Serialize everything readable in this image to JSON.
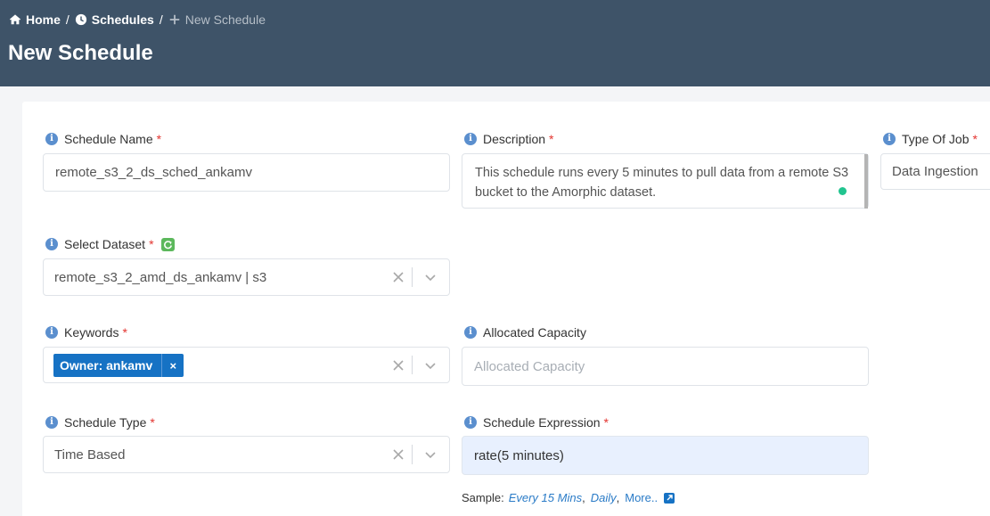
{
  "breadcrumb": {
    "home": "Home",
    "schedules": "Schedules",
    "current": "New Schedule",
    "separator": "/"
  },
  "page": {
    "title": "New Schedule"
  },
  "form": {
    "schedule_name": {
      "label": "Schedule Name",
      "value": "remote_s3_2_ds_sched_ankamv"
    },
    "description": {
      "label": "Description",
      "value": "This schedule runs every 5 minutes to pull data from a remote S3 bucket to the Amorphic dataset."
    },
    "type_of_job": {
      "label": "Type Of Job",
      "value": "Data Ingestion"
    },
    "select_dataset": {
      "label": "Select Dataset",
      "value": "remote_s3_2_amd_ds_ankamv | s3"
    },
    "keywords": {
      "label": "Keywords",
      "tag": "Owner: ankamv",
      "tag_remove": "×"
    },
    "allocated_capacity": {
      "label": "Allocated Capacity",
      "placeholder": "Allocated Capacity"
    },
    "schedule_type": {
      "label": "Schedule Type",
      "value": "Time Based"
    },
    "schedule_expression": {
      "label": "Schedule Expression",
      "value": "rate(5 minutes)"
    },
    "required_mark": "*",
    "info_glyph": "i"
  },
  "sample": {
    "prefix": "Sample:",
    "every_15": "Every 15 Mins",
    "comma1": ",",
    "daily": "Daily",
    "comma2": ",",
    "more": "More.."
  },
  "colors": {
    "header_bg": "#3e5368",
    "accent": "#1672c4",
    "required": "#e3342f",
    "info": "#5b8fce"
  },
  "icons": [
    "home-icon",
    "clock-icon",
    "plus-icon",
    "info-icon",
    "refresh-icon",
    "clear-icon",
    "chevron-down-icon",
    "external-link-icon"
  ]
}
